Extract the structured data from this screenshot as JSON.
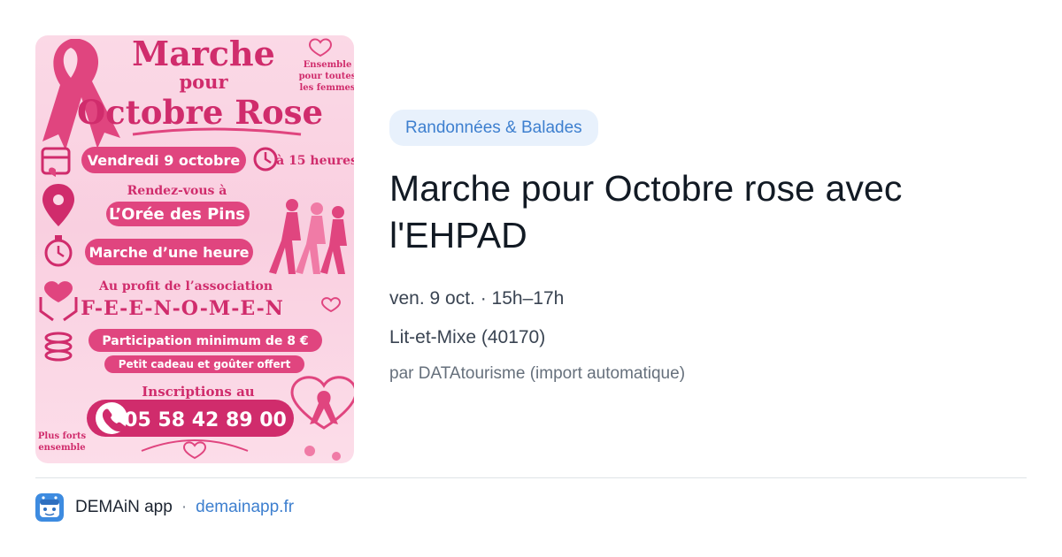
{
  "poster": {
    "title_line1": "Marche",
    "title_line2": "pour",
    "title_line3": "Octobre Rose",
    "side_note": [
      "Ensemble",
      "pour toutes",
      "les femmes"
    ],
    "date_label": "Vendredi 9 octobre",
    "time_label": "à 15 heures",
    "meeting_line1": "Rendez-vous à",
    "meeting_line2": "L’Orée des Pins",
    "duration_label": "Marche d’une heure",
    "benefit_line1": "Au profit de l’association",
    "benefit_line2": "F-E-E-N-O-M-E-N",
    "participation_label": "Participation minimum de 8 €",
    "gift_label": "Petit cadeau et goûter offert",
    "signup_label": "Inscriptions au",
    "phone": "05 58 42 89 00",
    "corner_note": [
      "Plus forts",
      "ensemble"
    ],
    "colors": {
      "primary": "#e0457f",
      "dark": "#d02c6c",
      "background": "#fbd9e6"
    }
  },
  "event": {
    "category": "Randonnées & Balades",
    "title": "Marche pour Octobre rose avec l'EHPAD",
    "date": "ven. 9 oct. · 15h–17h",
    "location": "Lit-et-Mixe (40170)",
    "author": "par DATAtourisme (import automatique)"
  },
  "footer": {
    "app_name": "DEMAiN app",
    "separator": "·",
    "link": "demainapp.fr",
    "logo_icon": "demain-app-logo-icon"
  },
  "colors": {
    "accent": "#3d7fcf",
    "badge_bg": "#e8f1fc",
    "title": "#121a24",
    "meta": "#3a4452",
    "muted": "#66707c"
  }
}
